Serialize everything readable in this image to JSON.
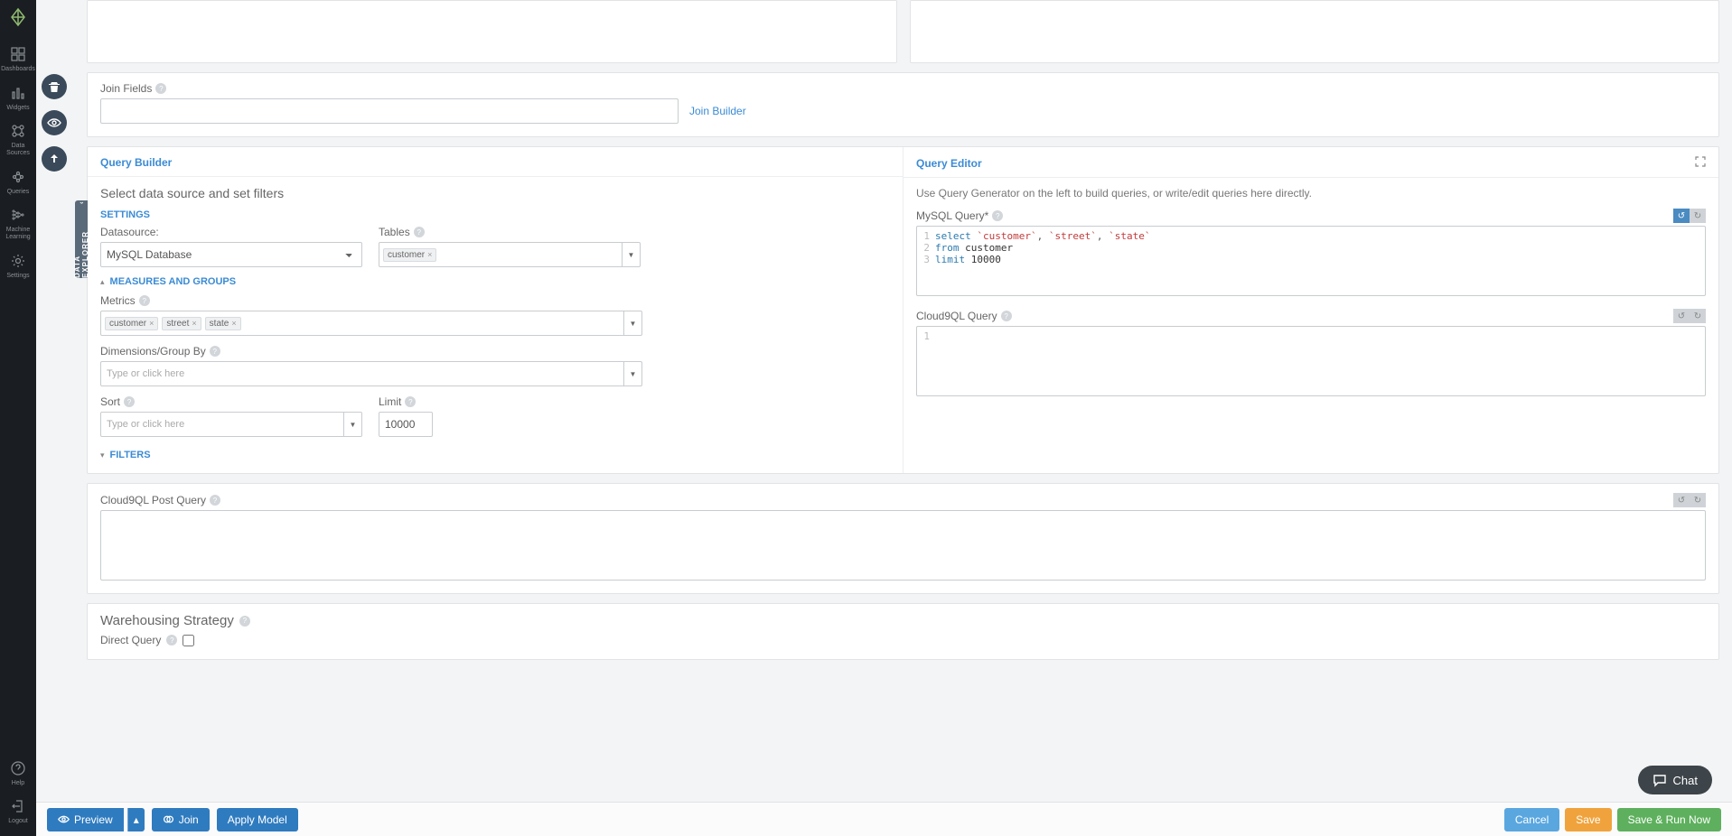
{
  "leftnav": {
    "items": [
      {
        "label": "Dashboards"
      },
      {
        "label": "Widgets"
      },
      {
        "label": "Data Sources"
      },
      {
        "label": "Queries"
      },
      {
        "label": "Machine Learning"
      },
      {
        "label": "Settings"
      }
    ],
    "help": "Help",
    "logout": "Logout"
  },
  "vertical_tab": "DATA EXPLORER",
  "top_panels": {
    "join_fields_label": "Join Fields",
    "join_builder_link": "Join Builder"
  },
  "query_builder": {
    "title": "Query Builder",
    "subhead": "Select data source and set filters",
    "settings_label": "SETTINGS",
    "datasource_label": "Datasource:",
    "datasource_value": "MySQL Database",
    "tables_label": "Tables",
    "tables_tags": [
      "customer"
    ],
    "measures_label": "MEASURES AND GROUPS",
    "metrics_label": "Metrics",
    "metrics_tags": [
      "customer",
      "street",
      "state"
    ],
    "dimensions_label": "Dimensions/Group By",
    "dimensions_placeholder": "Type or click here",
    "sort_label": "Sort",
    "sort_placeholder": "Type or click here",
    "limit_label": "Limit",
    "limit_value": "10000",
    "filters_label": "FILTERS"
  },
  "query_editor": {
    "title": "Query Editor",
    "hint": "Use Query Generator on the left to build queries, or write/edit queries here directly.",
    "mysql_label": "MySQL Query*",
    "mysql_lines": [
      {
        "n": "1",
        "html": "<span class='kw-select'>select</span> <span class='str'>`customer`</span>, <span class='str'>`street`</span>, <span class='str'>`state`</span>"
      },
      {
        "n": "2",
        "html": "<span class='kw-from'>from</span> <span class='ident'>customer</span>"
      },
      {
        "n": "3",
        "html": "<span class='kw-limit'>limit</span> <span class='num'>10000</span>"
      }
    ],
    "cloud9ql_label": "Cloud9QL Query",
    "cloud9ql_lines": [
      {
        "n": "1",
        "html": ""
      }
    ]
  },
  "post_query": {
    "label": "Cloud9QL Post Query"
  },
  "warehousing": {
    "label": "Warehousing Strategy",
    "direct_query_label": "Direct Query"
  },
  "bottombar": {
    "preview": "Preview",
    "join": "Join",
    "apply_model": "Apply Model",
    "cancel": "Cancel",
    "save": "Save",
    "save_run": "Save & Run Now"
  },
  "chat": "Chat"
}
